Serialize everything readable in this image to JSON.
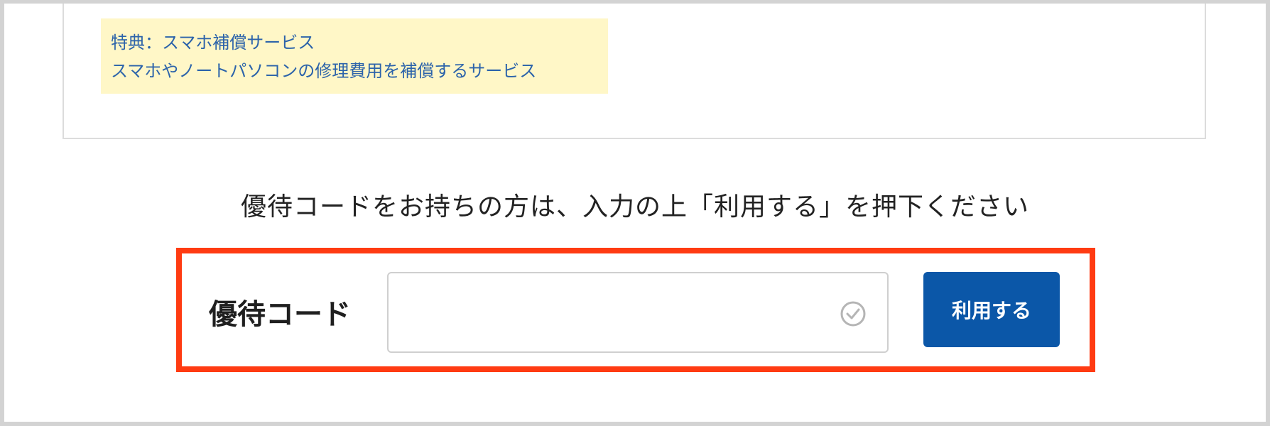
{
  "benefit": {
    "line1": "特典：スマホ補償サービス",
    "line2": "スマホやノートパソコンの修理費用を補償するサービス"
  },
  "instruction": "優待コードをお持ちの方は、入力の上「利用する」を押下ください",
  "coupon": {
    "label": "優待コード",
    "input_value": "",
    "input_placeholder": "",
    "check_icon": "check-circle-icon",
    "button_label": "利用する"
  },
  "colors": {
    "highlight_border": "#ff3b12",
    "button_bg": "#0b57a8",
    "benefit_bg": "#fff7c7",
    "benefit_text": "#2c63aa"
  }
}
